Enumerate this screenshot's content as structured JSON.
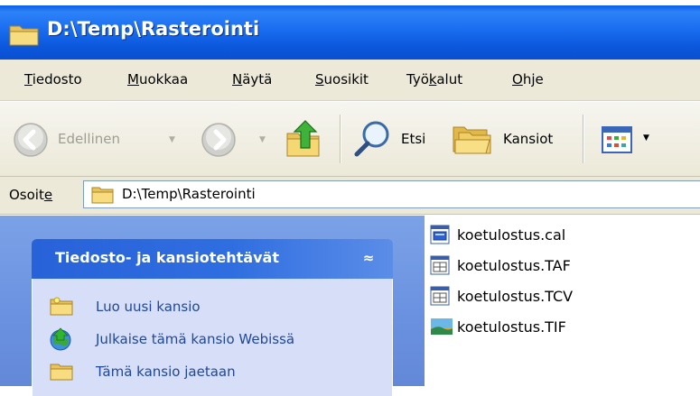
{
  "window": {
    "title": "D:\\Temp\\Rasterointi"
  },
  "menu": {
    "items": [
      {
        "accel": "T",
        "rest": "iedosto"
      },
      {
        "accel": "M",
        "rest": "uokkaa"
      },
      {
        "accel": "N",
        "rest": "äytä"
      },
      {
        "accel": "S",
        "rest": "uosikit"
      },
      {
        "pre": "Työ",
        "accel": "k",
        "rest": "alut"
      },
      {
        "accel": "O",
        "rest": "hje"
      }
    ]
  },
  "toolbar": {
    "back_label": "Edellinen",
    "search_label": "Etsi",
    "folders_label": "Kansiot"
  },
  "address": {
    "label_pre": "Osoit",
    "label_accel": "e",
    "path": "D:\\Temp\\Rasterointi"
  },
  "tasks": {
    "title": "Tiedosto- ja kansiotehtävät",
    "collapse_glyph": "≈",
    "links": [
      "Luo uusi kansio",
      "Julkaise tämä kansio Webissä",
      "Tämä kansio jaetaan"
    ]
  },
  "files": [
    {
      "name": "koetulostus.cal",
      "icon": "cal-file-icon"
    },
    {
      "name": "koetulostus.TAF",
      "icon": "taf-file-icon"
    },
    {
      "name": "koetulostus.TCV",
      "icon": "tcv-file-icon"
    },
    {
      "name": "koetulostus.TIF",
      "icon": "tif-image-icon"
    }
  ],
  "colors": {
    "titlebar": "#0c58dd",
    "taskpane": "#6a91e0",
    "task_header": "#2862d9",
    "task_link": "#21479b",
    "chrome": "#ece9d8"
  }
}
